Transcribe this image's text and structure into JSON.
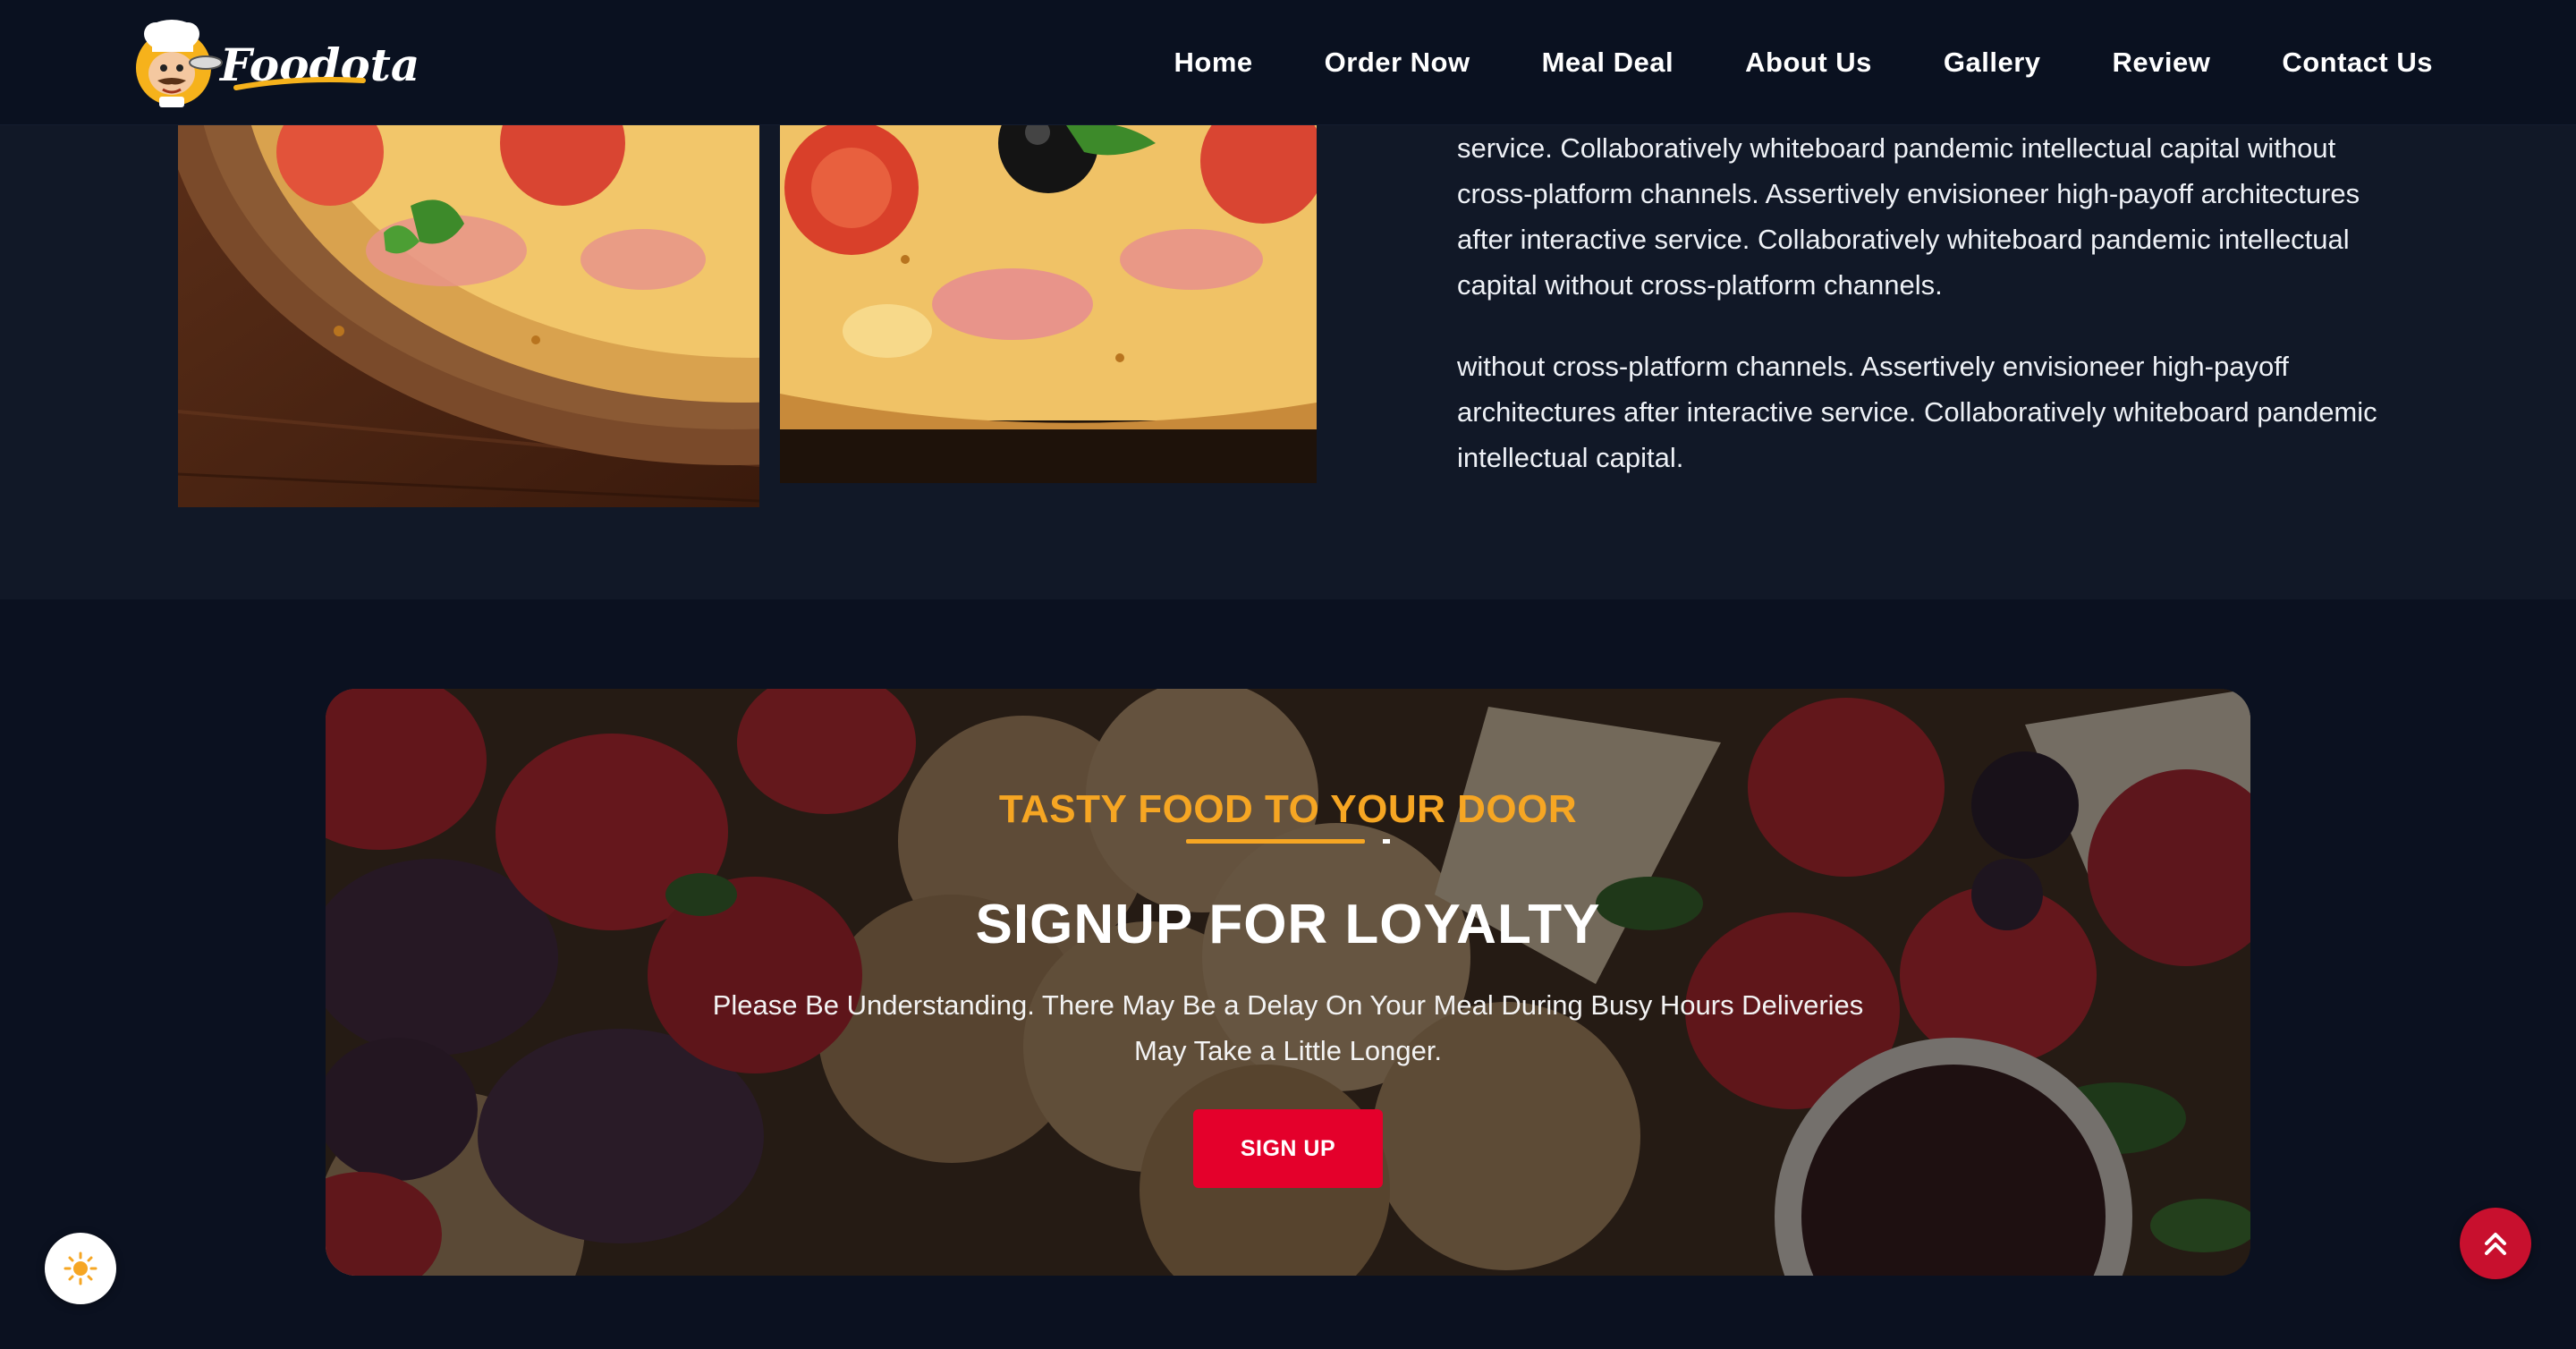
{
  "brand": {
    "name": "Foodota",
    "logo_icon": "chef-mascot-icon"
  },
  "nav": {
    "items": [
      {
        "label": "Home"
      },
      {
        "label": "Order Now"
      },
      {
        "label": "Meal Deal"
      },
      {
        "label": "About Us"
      },
      {
        "label": "Gallery"
      },
      {
        "label": "Review"
      },
      {
        "label": "Contact Us"
      }
    ]
  },
  "about": {
    "paragraphs": [
      "service. Collaboratively whiteboard pandemic intellectual capital without cross-platform channels. Assertively envisioneer high-payoff architectures after interactive service. Collaboratively whiteboard pandemic intellectual capital without cross-platform channels.",
      "without cross-platform channels. Assertively envisioneer high-payoff architectures after interactive service. Collaboratively whiteboard pandemic intellectual capital."
    ]
  },
  "loyalty": {
    "kicker": "TASTY FOOD TO YOUR DOOR",
    "title": "SIGNUP FOR LOYALTY",
    "description": "Please Be Understanding. There May Be a Delay On Your Meal During Busy Hours Deliveries May Take a Little Longer.",
    "button_label": "SIGN UP"
  },
  "floating": {
    "theme_icon": "sun-icon",
    "scroll_icon": "double-chevron-up-icon"
  },
  "colors": {
    "page_bg": "#0b1120",
    "section_bg": "#111827",
    "accent_orange": "#f6a623",
    "accent_red": "#e4002b"
  }
}
